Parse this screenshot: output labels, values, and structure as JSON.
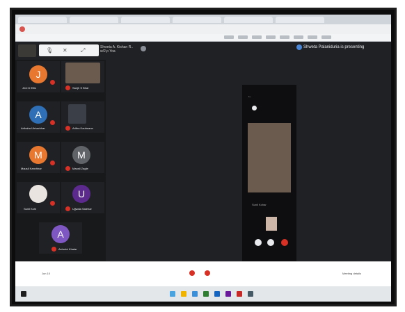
{
  "browser": {
    "tabs": [
      "",
      "",
      "",
      "",
      "",
      ""
    ],
    "address": ""
  },
  "meet": {
    "presenter_name": "Shweta A. Kishan R..",
    "presenter_sub": "w/2.p Yoa",
    "presenting_banner": "Shweta Palaniduria is presenting",
    "participants": [
      {
        "initial": "J",
        "name": "Jeni D Ellis",
        "color": "#e8782f"
      },
      {
        "initial": "",
        "name": "Sanjh S Bhar",
        "color": "#4a4a4a"
      },
      {
        "initial": "A",
        "name": "Arthaha Ulrhachhar",
        "color": "#2f6fb5"
      },
      {
        "initial": "",
        "name": "Aritha Kaufmann",
        "color": "#4a4a4a"
      },
      {
        "initial": "M",
        "name": "Mausil Kanvhhar",
        "color": "#e8782f"
      },
      {
        "initial": "M",
        "name": "Mausil Zagle",
        "color": "#606368"
      },
      {
        "initial": "",
        "name": "Sunil Kohi",
        "color": "#d9d9d9"
      },
      {
        "initial": "U",
        "name": "Ujjwala Salehar",
        "color": "#5b2a8c"
      },
      {
        "initial": "A",
        "name": "Ashwini Khalar",
        "color": "#7e57c2"
      }
    ],
    "phone_caption": "Sunil Kohar"
  },
  "bottom": {
    "left_text": "Jun 10",
    "right_text": "Meeting details"
  }
}
